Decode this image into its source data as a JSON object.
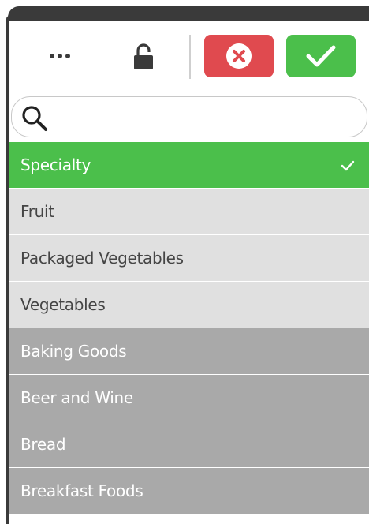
{
  "toolbar": {
    "more_icon": "more-options-icon",
    "lock_icon": "unlock-icon",
    "cancel_icon": "close-circle-icon",
    "confirm_icon": "checkmark-icon",
    "cancel_color": "#e04a4f",
    "confirm_color": "#4bbf4b"
  },
  "search": {
    "icon": "search-icon",
    "value": "",
    "placeholder": ""
  },
  "list": {
    "items": [
      {
        "label": "Specialty",
        "state": "selected"
      },
      {
        "label": "Fruit",
        "state": "alternative"
      },
      {
        "label": "Packaged Vegetables",
        "state": "alternative"
      },
      {
        "label": "Vegetables",
        "state": "alternative"
      },
      {
        "label": "Baking Goods",
        "state": "excluded"
      },
      {
        "label": "Beer and Wine",
        "state": "excluded"
      },
      {
        "label": "Bread",
        "state": "excluded"
      },
      {
        "label": "Breakfast Foods",
        "state": "excluded"
      }
    ]
  },
  "colors": {
    "selected": "#4bbf4b",
    "alternative": "#e0e0e0",
    "excluded": "#a9a9a9",
    "frame": "#3a3a3a"
  }
}
